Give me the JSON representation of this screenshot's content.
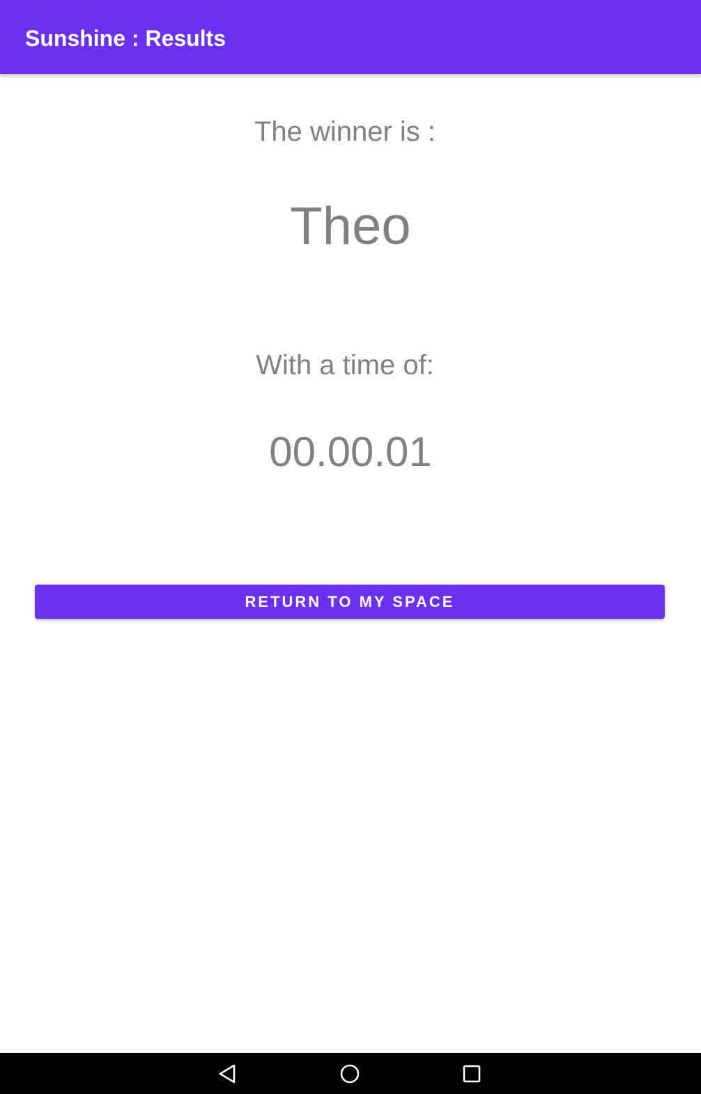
{
  "app_bar": {
    "title": "Sunshine : Results",
    "color": "#6a31f0"
  },
  "results": {
    "winner_label": "The winner is :",
    "winner_name": "Theo",
    "time_label": "With a time of:",
    "time_value": "00.00.01"
  },
  "actions": {
    "return_label": "RETURN TO MY SPACE"
  },
  "nav_bar": {
    "icons": [
      "back-icon",
      "home-icon",
      "recents-icon"
    ]
  }
}
